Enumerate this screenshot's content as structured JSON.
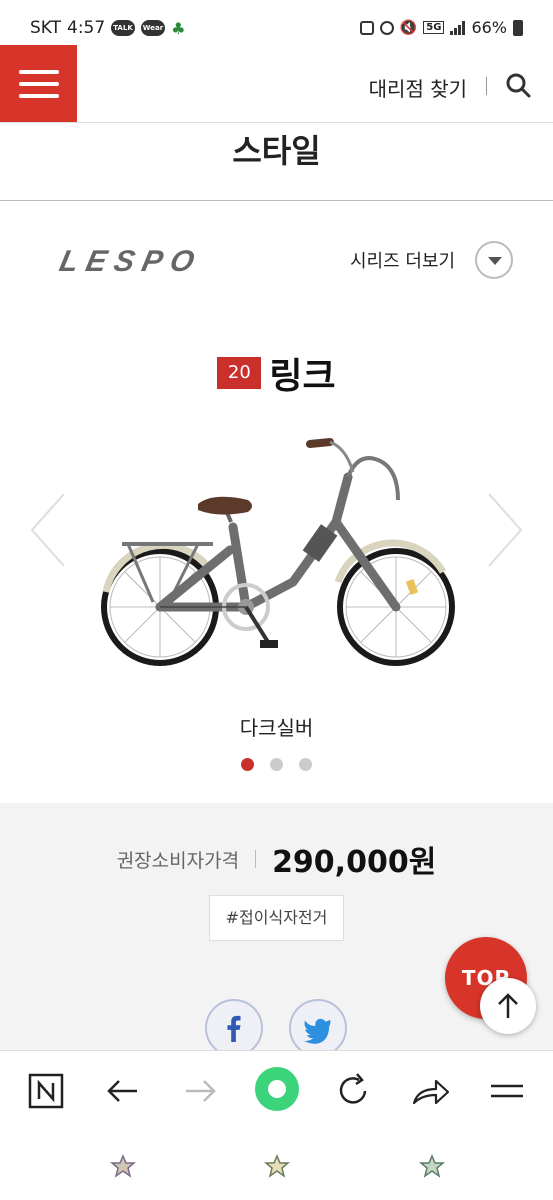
{
  "status_bar": {
    "carrier": "SKT",
    "time": "4:57",
    "notif_talk": "TALK",
    "notif_wear": "Wear",
    "network": "5G",
    "battery": "66%"
  },
  "header": {
    "dealer_link": "대리점 찾기"
  },
  "page_title": "스타일",
  "brand": {
    "logo_text": "LESPO",
    "series_more": "시리즈 더보기"
  },
  "product": {
    "size_badge": "20",
    "name": "링크",
    "color_name": "다크실버",
    "slide_count": 3,
    "active_slide": 0,
    "price_label": "권장소비자가격",
    "price": "290,000원",
    "tag": "#접이식자전거"
  },
  "floating": {
    "top_label": "TOP"
  },
  "colors": {
    "accent": "#d8352a",
    "badge": "#c9302c"
  }
}
